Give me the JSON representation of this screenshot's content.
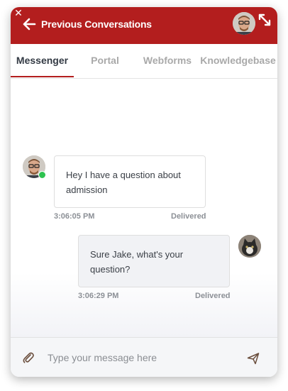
{
  "header": {
    "title": "Previous Conversations",
    "close_glyph": "✕",
    "icons": [
      "close-icon",
      "back-arrow-icon",
      "expand-icon"
    ],
    "color": "#b31e1e"
  },
  "tabs": [
    {
      "label": "Messenger",
      "active": true
    },
    {
      "label": "Portal",
      "active": false
    },
    {
      "label": "Webforms",
      "active": false
    },
    {
      "label": "Knowledgebase",
      "active": false
    }
  ],
  "messages": [
    {
      "direction": "incoming",
      "text": "Hey I have a question about admission",
      "time": "3:06:05 PM",
      "status": "Delivered",
      "presence": "online"
    },
    {
      "direction": "outgoing",
      "text": "Sure Jake, what's your question?",
      "time": "3:06:29 PM",
      "status": "Delivered"
    }
  ],
  "composer": {
    "placeholder": "Type your message here",
    "value": "",
    "icons": [
      "paperclip-icon",
      "send-icon"
    ]
  }
}
